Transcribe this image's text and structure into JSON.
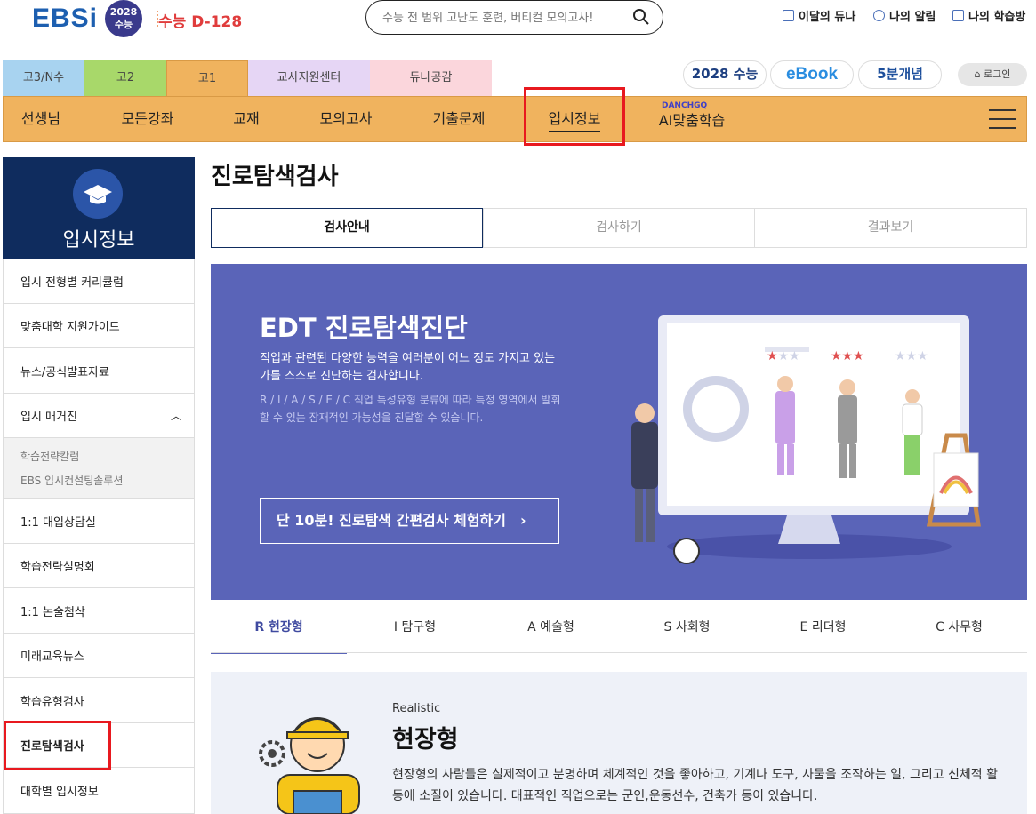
{
  "header": {
    "logo_text": "EBSi",
    "logo_badge_year": "2028",
    "logo_badge_label": "수능",
    "dday": "수능 D-128",
    "search_placeholder": "수능 전 범위 고난도 훈련, 버티컬 모의고사!",
    "links": [
      "이달의 듀나",
      "나의 알림",
      "나의 학습방"
    ]
  },
  "grade_tabs": [
    "고3/N수",
    "고2",
    "고1",
    "교사지원센터",
    "듀나공감"
  ],
  "quick": {
    "suneung": "2028 수능",
    "ebook": "eBook",
    "concept": "5분개념",
    "login": "로그인"
  },
  "gnb": [
    "선생님",
    "모든강좌",
    "교재",
    "모의고사",
    "기출문제",
    "입시정보",
    "AI맞춤학습"
  ],
  "gnb_ai_badge": "DANCHGQ",
  "sidebar": {
    "title": "입시정보",
    "items": [
      "입시 전형별 커리큘럼",
      "맞춤대학 지원가이드",
      "뉴스/공식발표자료",
      "입시 매거진",
      "1:1 대입상담실",
      "학습전략설명회",
      "1:1 논술첨삭",
      "미래교육뉴스",
      "학습유형검사",
      "진로탐색검사",
      "대학별 입시정보"
    ],
    "sub_items": [
      "학습전략칼럼",
      "EBS 입시컨설팅솔루션"
    ]
  },
  "main": {
    "title": "진로탐색검사",
    "tabs": [
      "검사안내",
      "검사하기",
      "결과보기"
    ],
    "banner": {
      "title": "EDT 진로탐색진단",
      "desc1": "직업과 관련된 다양한 능력을 여러분이 어느 정도 가지고 있는가를 스스로 진단하는 검사합니다.",
      "desc2": "R / I / A / S / E / C 직업 특성유형 분류에 따라 특정 영역에서 발휘할 수 있는 잠재적인 가능성을 진달할 수 있습니다.",
      "button": "단 10분! 진로탐색 간편검사 체험하기"
    },
    "type_tabs": [
      "R 현장형",
      "I 탐구형",
      "A 예술형",
      "S 사회형",
      "E 리더형",
      "C 사무형"
    ],
    "type_detail": {
      "en": "Realistic",
      "name": "현장형",
      "desc": "현장형의 사람들은 실제적이고 분명하며 체계적인 것을 좋아하고, 기계나 도구, 사물을 조작하는 일, 그리고 신체적 활동에 소질이 있습니다. 대표적인 직업으로는 군인,운동선수, 건축가 등이 있습니다."
    }
  },
  "colors": {
    "accent": "#f0b35e",
    "brand": "#1d5fb0",
    "banner": "#5a64b8",
    "sidebar": "#0f2c5e",
    "highlight": "#e8191f"
  }
}
